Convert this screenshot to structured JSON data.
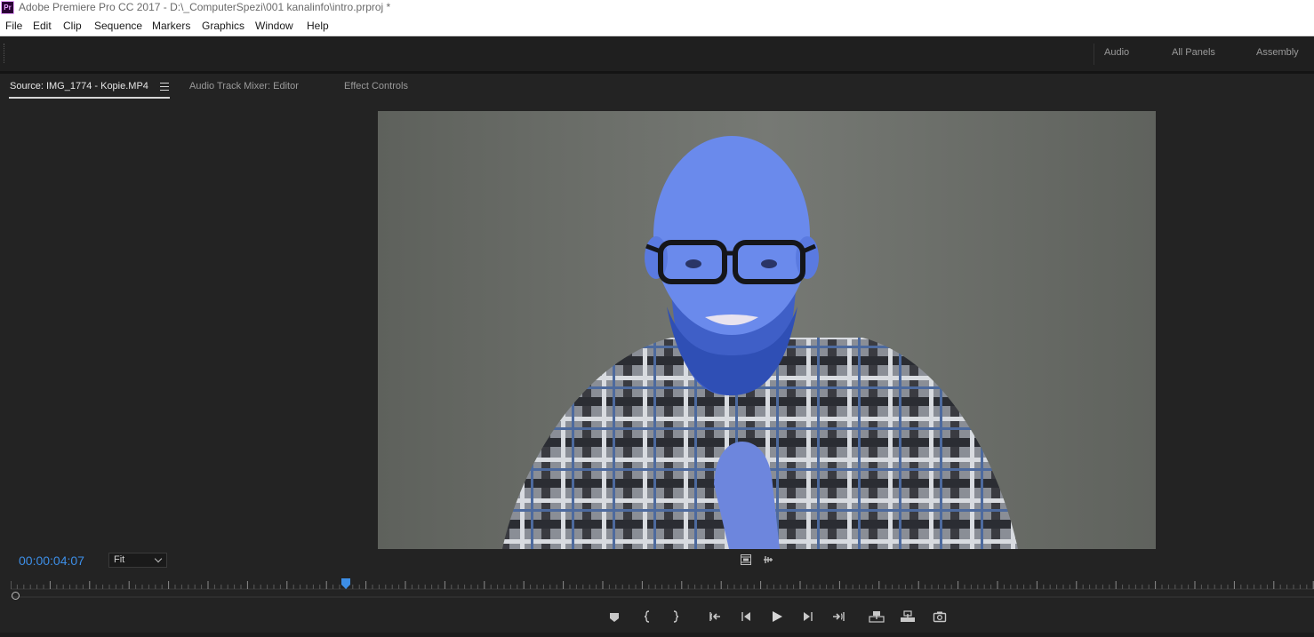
{
  "window": {
    "app_icon": "Pr",
    "title": "Adobe Premiere Pro CC 2017 - D:\\_ComputerSpezi\\001 kanalinfo\\intro.prproj *"
  },
  "menu": {
    "items": [
      {
        "label": "File"
      },
      {
        "label": "Edit"
      },
      {
        "label": "Clip"
      },
      {
        "label": "Sequence"
      },
      {
        "label": "Markers"
      },
      {
        "label": "Graphics"
      },
      {
        "label": "Window"
      },
      {
        "label": "Help"
      }
    ]
  },
  "workspaces": {
    "tabs": [
      {
        "label": "Audio"
      },
      {
        "label": "All Panels"
      },
      {
        "label": "Assembly"
      }
    ]
  },
  "panel": {
    "tabs": [
      {
        "label": "Source: IMG_1774 - Kopie.MP4",
        "active": true
      },
      {
        "label": "Audio Track Mixer: Editor",
        "active": false
      },
      {
        "label": "Effect Controls",
        "active": false
      }
    ],
    "menu_icon": "hamburger-menu-icon"
  },
  "monitor": {
    "timecode": "00:00:04:07",
    "zoom": "Fit",
    "icons": [
      "drag-video-icon",
      "drag-audio-icon"
    ]
  },
  "transport": {
    "buttons": [
      "add-marker-icon",
      "mark-in-icon",
      "mark-out-icon",
      "go-to-in-icon",
      "step-back-icon",
      "play-icon",
      "step-forward-icon",
      "go-to-out-icon",
      "insert-icon",
      "overwrite-icon",
      "export-frame-icon"
    ]
  },
  "colors": {
    "timecode": "#3d8ee6",
    "playhead": "#3d8ee6",
    "panel_bg": "#232323"
  }
}
